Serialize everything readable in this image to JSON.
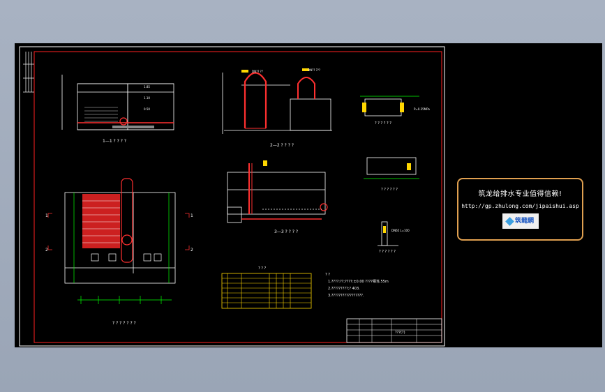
{
  "views": {
    "section_1_1": "1—1 ? ? ? ?",
    "section_2_2": "2—2 ? ? ? ?",
    "section_3_3": "3—3 ? ? ? ?",
    "plan": "? ? ? ? ? ? ?",
    "detail_a": "? ? ? ? ? ?",
    "detail_b": "? ? ? ? ? ?",
    "detail_c": "? ? ? ? ? ?"
  },
  "markers": {
    "one": "1",
    "two": "2"
  },
  "table": {
    "title": "? ? ?"
  },
  "notes": {
    "title": "? ?",
    "line1": "1.????:??;????:±0.00 ????相当.55m",
    "line2": "2.?????????;? 403.",
    "line3": "3.?????????????????."
  },
  "title_block": {
    "sheet_name": "???(?)"
  },
  "ad": {
    "line1": "筑龙给排水专业值得信赖!",
    "url": "http://gp.zhulong.com/jipaishui.asp",
    "logo": "筑龍網"
  },
  "colors": {
    "background": "#000000",
    "frame": "#ff2020",
    "outer_frame": "#ffffff",
    "dims": "#00ff00",
    "text": "#ffffff",
    "ad_border": "#e0a050"
  }
}
